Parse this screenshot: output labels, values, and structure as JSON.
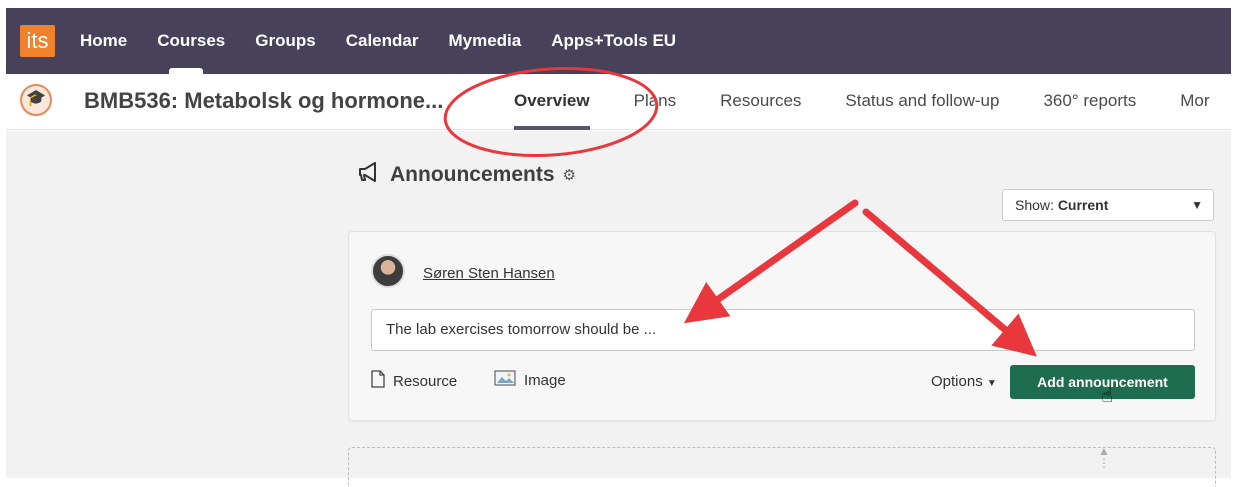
{
  "topnav": {
    "logo_text": "its",
    "items": [
      {
        "label": "Home"
      },
      {
        "label": "Courses",
        "active": true
      },
      {
        "label": "Groups"
      },
      {
        "label": "Calendar"
      },
      {
        "label": "Mymedia"
      },
      {
        "label": "Apps+Tools EU"
      }
    ]
  },
  "course": {
    "title": "BMB536: Metabolsk og hormone...",
    "tabs": [
      {
        "label": "Overview",
        "active": true
      },
      {
        "label": "Plans"
      },
      {
        "label": "Resources"
      },
      {
        "label": "Status and follow-up"
      },
      {
        "label": "360° reports"
      },
      {
        "label": "Mor"
      }
    ]
  },
  "announcements": {
    "heading": "Announcements",
    "show_prefix": "Show: ",
    "show_value": "Current",
    "author": "Søren Sten Hansen",
    "input_value": "The lab exercises tomorrow should be ...",
    "resource_label": "Resource",
    "image_label": "Image",
    "options_label": "Options",
    "add_button": "Add announcement"
  },
  "colors": {
    "topbar": "#47415a",
    "logo": "#f0822d",
    "add_button": "#1f6d50",
    "annotation": "#e8383d"
  },
  "icons": [
    "graduation-cap-icon",
    "megaphone-icon",
    "gear-icon",
    "chevron-down-icon",
    "file-icon",
    "image-icon",
    "hand-cursor-icon"
  ]
}
